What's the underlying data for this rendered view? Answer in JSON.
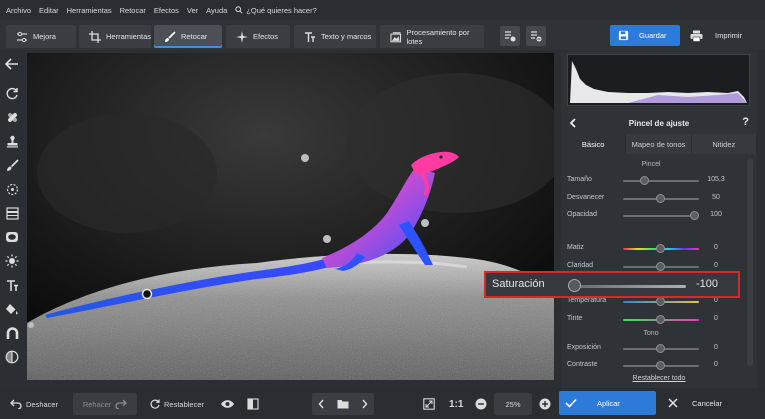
{
  "menu": {
    "items": [
      "Archivo",
      "Editar",
      "Herramientas",
      "Retocar",
      "Efectos",
      "Ver",
      "Ayuda"
    ],
    "search_placeholder": "¿Qué quieres hacer?"
  },
  "toolbar": {
    "tabs": [
      {
        "label": "Mejora",
        "icon": "sliders-icon"
      },
      {
        "label": "Herramientas",
        "icon": "crop-icon"
      },
      {
        "label": "Retocar",
        "icon": "brush-icon"
      },
      {
        "label": "Efectos",
        "icon": "sparkle-icon"
      },
      {
        "label": "Texto y marcos",
        "icon": "text-icon"
      },
      {
        "label": "Procesamiento por lotes",
        "icon": "batch-icon"
      }
    ],
    "active_tab": "Retocar",
    "save_label": "Guardar",
    "print_label": "Imprimir",
    "accent_color": "#2d7bd9"
  },
  "panel": {
    "title": "Pincel de ajuste",
    "help": "?",
    "subtabs": [
      "Básico",
      "Mapeo de tonos",
      "Nitidez"
    ],
    "active_subtab": "Básico",
    "section_brush": "Pincel",
    "brush": [
      {
        "label": "Tamaño",
        "value": "105,3",
        "level": 0.3
      },
      {
        "label": "Desvanecer",
        "value": "50",
        "level": 0.5
      },
      {
        "label": "Opacidad",
        "value": "100",
        "level": 1.0
      }
    ],
    "color_sliders": [
      {
        "label": "Matiz",
        "value": "0",
        "level": 0.5
      },
      {
        "label": "Claridad",
        "value": "0",
        "level": 0.5
      },
      {
        "label": "Temperatura",
        "value": "0",
        "level": 0.5
      },
      {
        "label": "Tinte",
        "value": "0",
        "level": 0.5
      }
    ],
    "section_tone": "Tono",
    "tone_sliders": [
      {
        "label": "Exposición",
        "value": "0",
        "level": 0.5
      },
      {
        "label": "Contraste",
        "value": "0",
        "level": 0.5
      }
    ],
    "restore_all": "Restablecer todo"
  },
  "highlight": {
    "label": "Saturación",
    "value": "-100",
    "level": 0.0,
    "border_color": "#d42a2a"
  },
  "bottom": {
    "undo": "Deshacer",
    "redo": "Rehacer",
    "reset": "Restablecer",
    "ratio": "1:1",
    "zoom": "25%",
    "apply": "Aplicar",
    "cancel": "Cancelar"
  }
}
